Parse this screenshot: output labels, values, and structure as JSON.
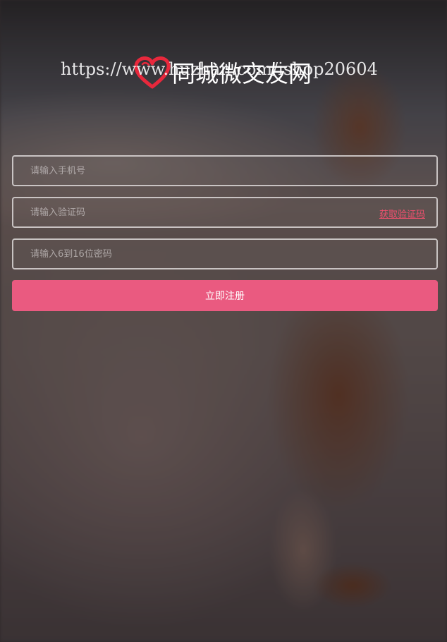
{
  "brand": {
    "title": "同城微交友网",
    "watermark": "https://www.huzhan.com/ishop20604",
    "heart_color": "#e8283c"
  },
  "form": {
    "phone": {
      "placeholder": "请输入手机号",
      "value": ""
    },
    "code": {
      "placeholder": "请输入验证码",
      "value": "",
      "get_code_label": "获取验证码"
    },
    "password": {
      "placeholder": "请输入6到16位密码",
      "value": ""
    },
    "submit_label": "立即注册"
  },
  "colors": {
    "accent": "#ea5a80",
    "link": "#f0506e"
  }
}
